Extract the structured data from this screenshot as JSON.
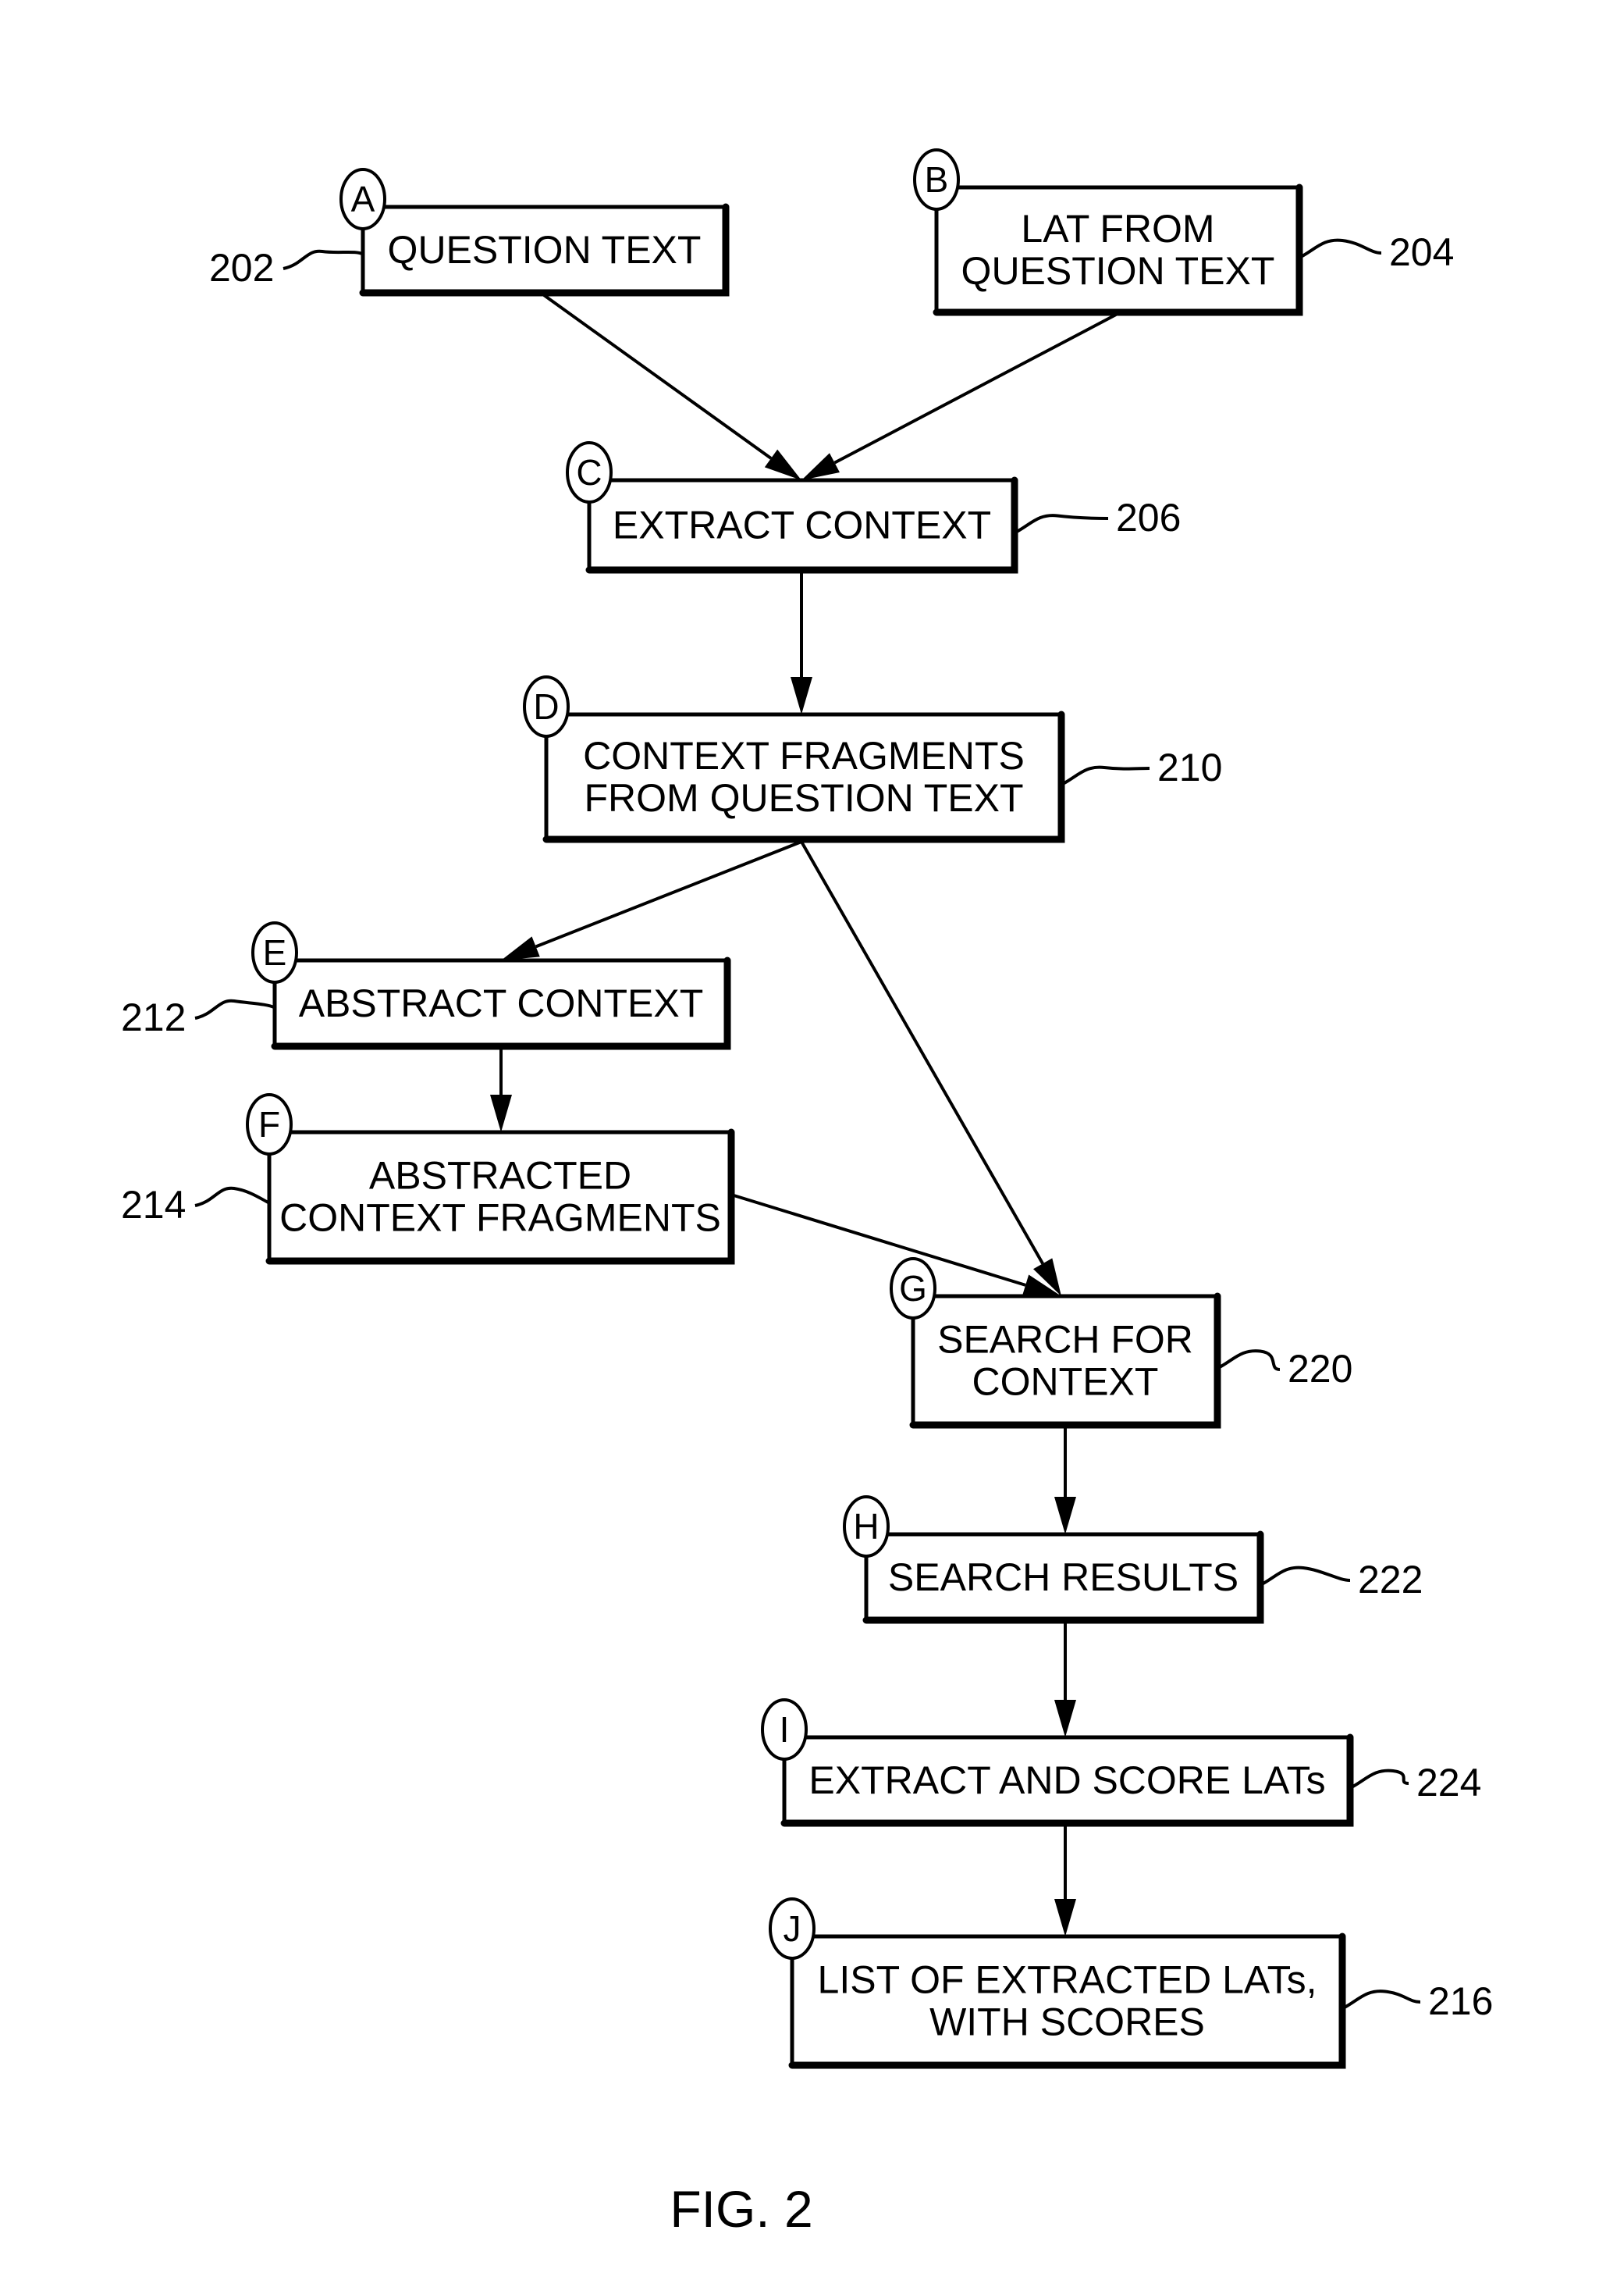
{
  "figure": {
    "label": "FIG. 2",
    "nodes": [
      {
        "id": "A",
        "ref": "202",
        "lines": [
          "QUESTION TEXT"
        ]
      },
      {
        "id": "B",
        "ref": "204",
        "lines": [
          "LAT FROM",
          "QUESTION TEXT"
        ]
      },
      {
        "id": "C",
        "ref": "206",
        "lines": [
          "EXTRACT CONTEXT"
        ]
      },
      {
        "id": "D",
        "ref": "210",
        "lines": [
          "CONTEXT FRAGMENTS",
          "FROM QUESTION TEXT"
        ]
      },
      {
        "id": "E",
        "ref": "212",
        "lines": [
          "ABSTRACT CONTEXT"
        ]
      },
      {
        "id": "F",
        "ref": "214",
        "lines": [
          "ABSTRACTED",
          "CONTEXT FRAGMENTS"
        ]
      },
      {
        "id": "G",
        "ref": "220",
        "lines": [
          "SEARCH FOR",
          "CONTEXT"
        ]
      },
      {
        "id": "H",
        "ref": "222",
        "lines": [
          "SEARCH RESULTS"
        ]
      },
      {
        "id": "I",
        "ref": "224",
        "lines": [
          "EXTRACT AND SCORE LATs"
        ]
      },
      {
        "id": "J",
        "ref": "216",
        "lines": [
          "LIST OF EXTRACTED LATs,",
          "WITH SCORES"
        ]
      }
    ],
    "edges": [
      {
        "from": "A",
        "to": "C"
      },
      {
        "from": "B",
        "to": "C"
      },
      {
        "from": "C",
        "to": "D"
      },
      {
        "from": "D",
        "to": "E"
      },
      {
        "from": "D",
        "to": "G"
      },
      {
        "from": "E",
        "to": "F"
      },
      {
        "from": "F",
        "to": "G"
      },
      {
        "from": "G",
        "to": "H"
      },
      {
        "from": "H",
        "to": "I"
      },
      {
        "from": "I",
        "to": "J"
      }
    ]
  }
}
